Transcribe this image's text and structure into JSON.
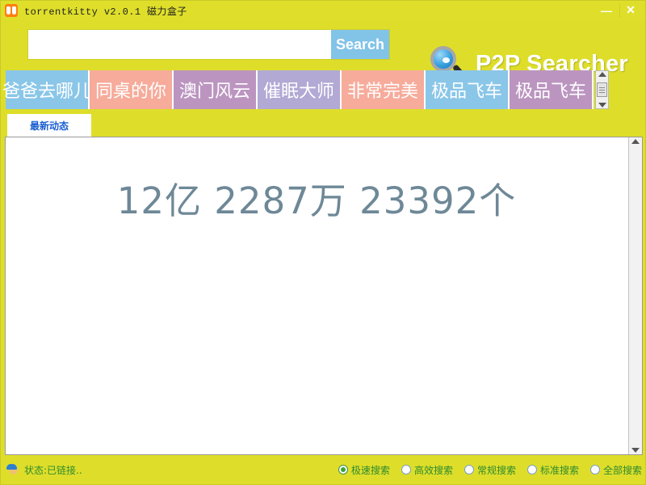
{
  "window": {
    "title": "torrentkitty  v2.0.1 磁力盒子",
    "app_icon": "binoculars-icon",
    "minimize_label": "—",
    "close_label": "✕",
    "background_color": "#dede2a"
  },
  "search": {
    "value": "",
    "placeholder": "",
    "button_label": "Search",
    "button_color": "#82c3e8"
  },
  "brand": {
    "icon": "magnifier-icon",
    "text": "P2P Searcher",
    "text_color": "#ffffff"
  },
  "movie_tabs": [
    {
      "label": "爸爸去哪儿",
      "color": "#8ac6e8"
    },
    {
      "label": "同桌的你",
      "color": "#f6ab9b"
    },
    {
      "label": "澳门风云",
      "color": "#bb95c0"
    },
    {
      "label": "催眠大师",
      "color": "#b2a9d4"
    },
    {
      "label": "非常完美",
      "color": "#f6ab9b"
    },
    {
      "label": "极品飞车",
      "color": "#8ac6e8"
    },
    {
      "label": "极品飞车",
      "color": "#bb95c0"
    }
  ],
  "tab_scrollbar": {
    "up_icon": "caret-up-icon",
    "down_icon": "caret-down-icon",
    "thumb": "scroll-thumb"
  },
  "section_tabs": [
    {
      "label": "最新动态",
      "active": true
    }
  ],
  "content": {
    "headline": "12亿 2287万 23392个",
    "headline_color": "#6e8897",
    "scrollbar": {
      "up_icon": "caret-up-icon",
      "down_icon": "caret-down-icon"
    }
  },
  "status": {
    "icon": "user-status-icon",
    "text": "状态:已链接..",
    "text_color": "#2e8b2e"
  },
  "search_modes": [
    {
      "label": "极速搜索",
      "selected": true
    },
    {
      "label": "高效搜索",
      "selected": false
    },
    {
      "label": "常规搜索",
      "selected": false
    },
    {
      "label": "标准搜索",
      "selected": false
    },
    {
      "label": "全部搜索",
      "selected": false
    }
  ]
}
